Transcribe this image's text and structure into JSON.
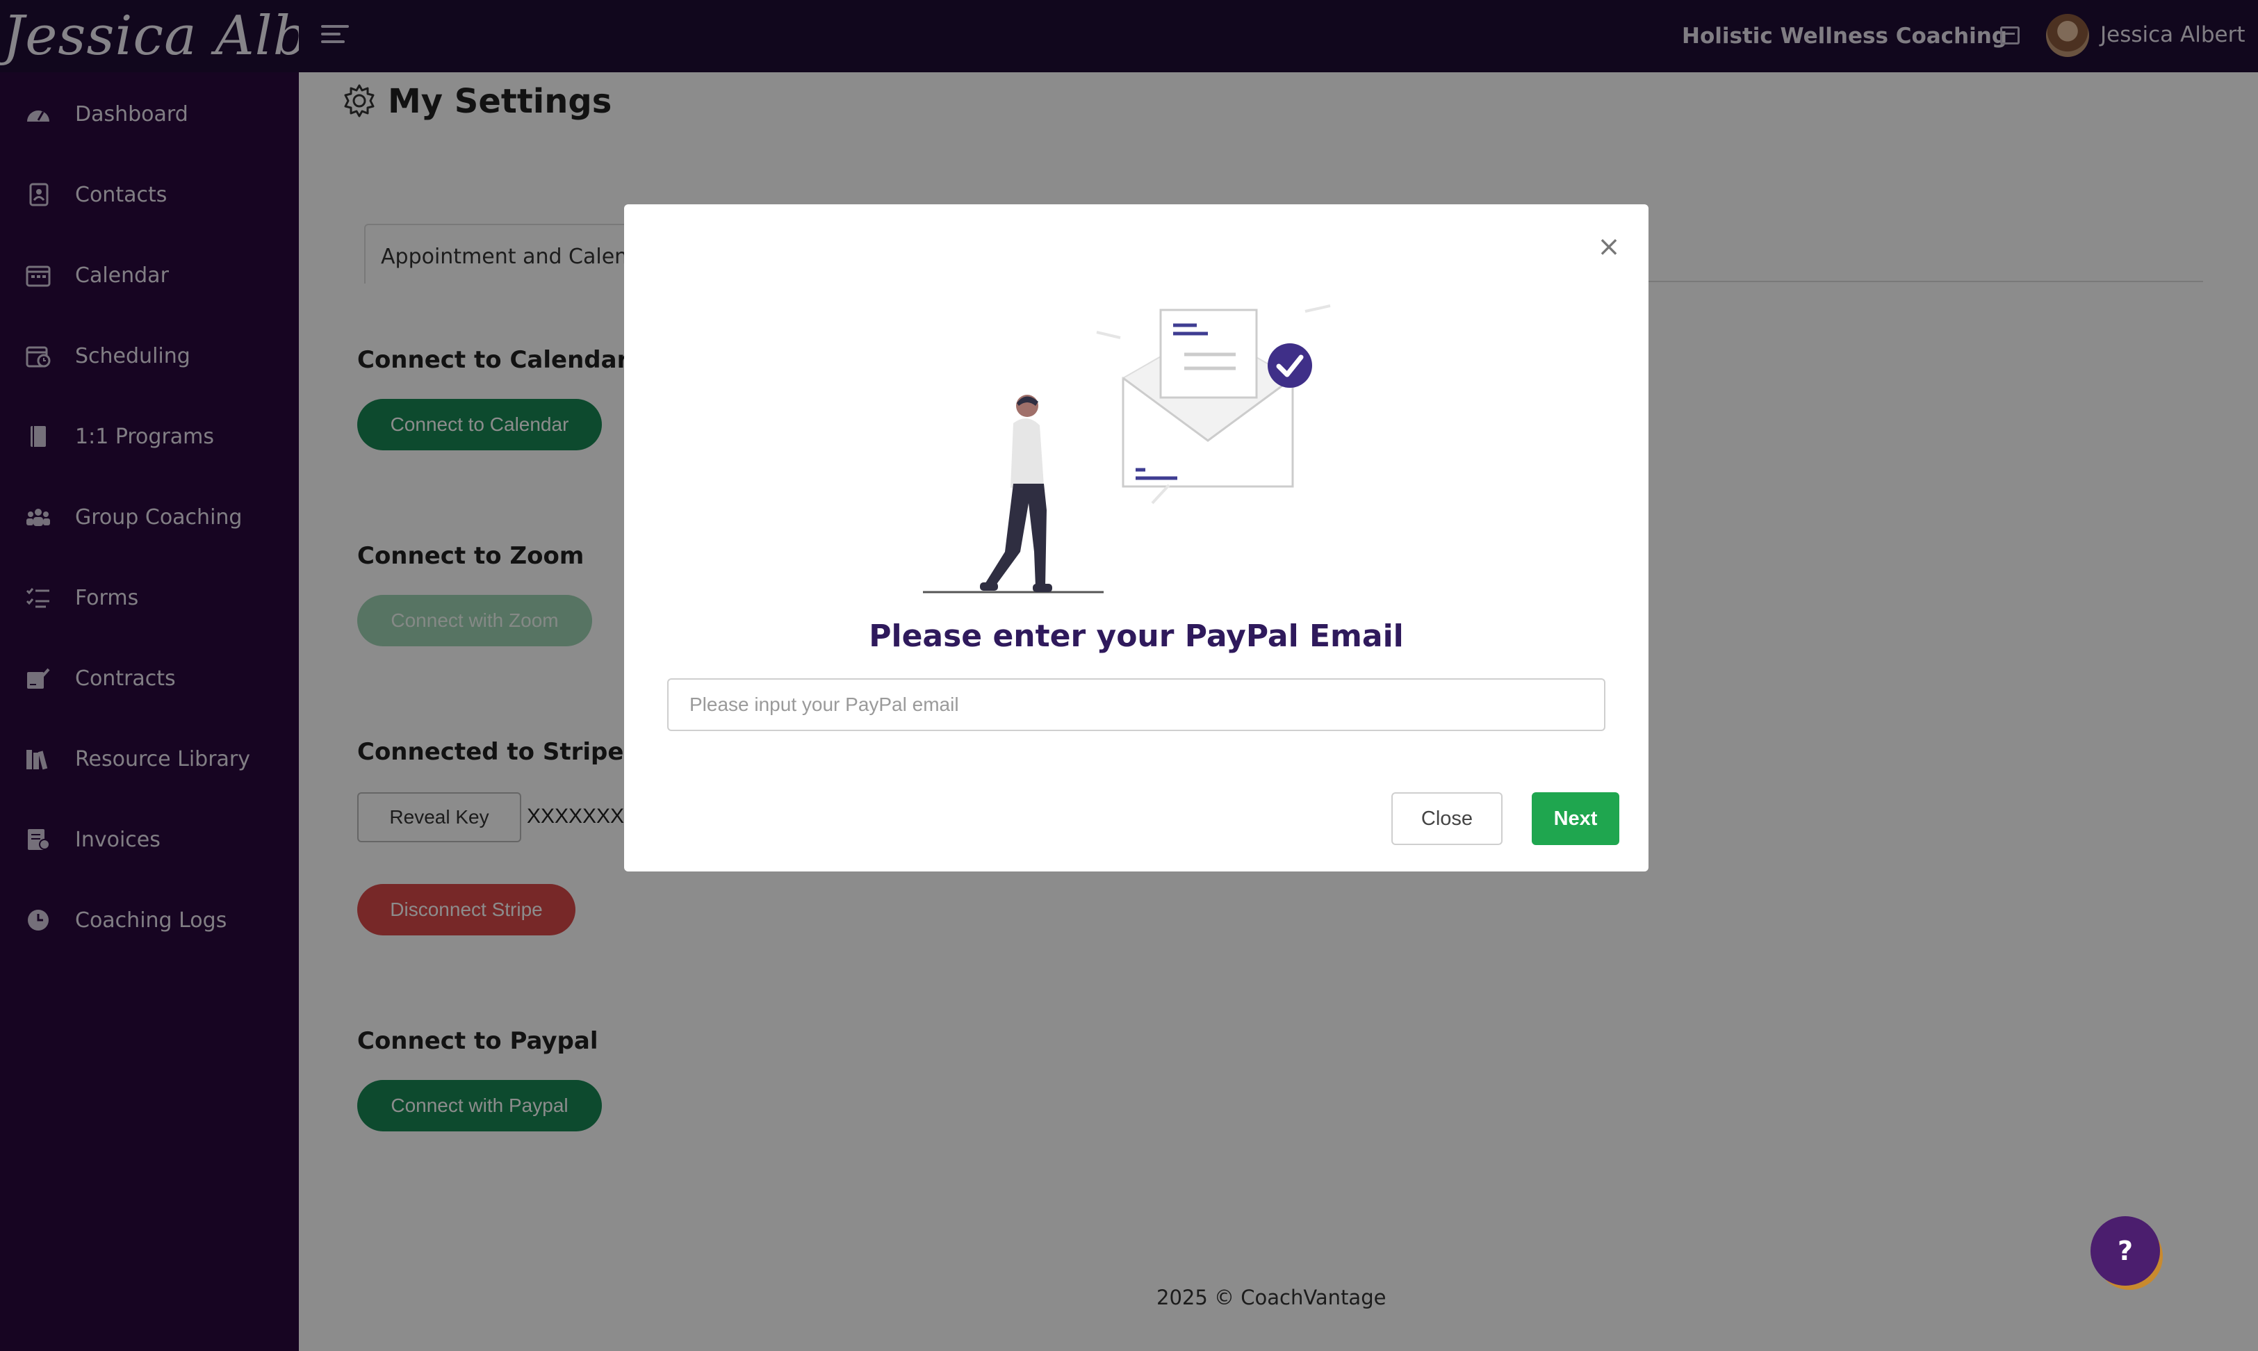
{
  "topbar": {
    "logo": "Jessica Albert",
    "org_name": "Holistic Wellness Coaching",
    "user_name": "Jessica Albert"
  },
  "sidebar": {
    "items": [
      {
        "label": "Dashboard",
        "icon": "dashboard-icon"
      },
      {
        "label": "Contacts",
        "icon": "contacts-icon"
      },
      {
        "label": "Calendar",
        "icon": "calendar-icon"
      },
      {
        "label": "Scheduling",
        "icon": "scheduling-icon"
      },
      {
        "label": "1:1 Programs",
        "icon": "book-icon"
      },
      {
        "label": "Group Coaching",
        "icon": "group-icon"
      },
      {
        "label": "Forms",
        "icon": "forms-icon"
      },
      {
        "label": "Contracts",
        "icon": "contract-icon"
      },
      {
        "label": "Resource Library",
        "icon": "library-icon"
      },
      {
        "label": "Invoices",
        "icon": "invoice-icon"
      },
      {
        "label": "Coaching Logs",
        "icon": "clock-icon"
      }
    ]
  },
  "main": {
    "title": "My Settings",
    "tab_label": "Appointment and Calendar",
    "sections": {
      "calendars": {
        "title": "Connect to Calendars",
        "button": "Connect to Calendar"
      },
      "zoom": {
        "title": "Connect to Zoom",
        "button": "Connect with Zoom"
      },
      "stripe": {
        "title": "Connected to Stripe",
        "reveal_button": "Reveal Key",
        "masked_key": "XXXXXXXX",
        "disconnect_button": "Disconnect Stripe"
      },
      "paypal": {
        "title": "Connect to Paypal",
        "button": "Connect with Paypal"
      }
    },
    "footer": "2025 © CoachVantage"
  },
  "modal": {
    "title": "Please enter your PayPal Email",
    "input_placeholder": "Please input your PayPal email",
    "input_value": "",
    "close_button": "Close",
    "next_button": "Next",
    "close_icon": "×"
  },
  "help": {
    "label": "?"
  },
  "colors": {
    "topbar": "#1f0d36",
    "sidebar": "#2a0a3e",
    "primary_green": "#198754",
    "danger_red": "#d94a4a",
    "modal_title": "#2f1a5c",
    "accent_purple": "#4b1e6e"
  }
}
